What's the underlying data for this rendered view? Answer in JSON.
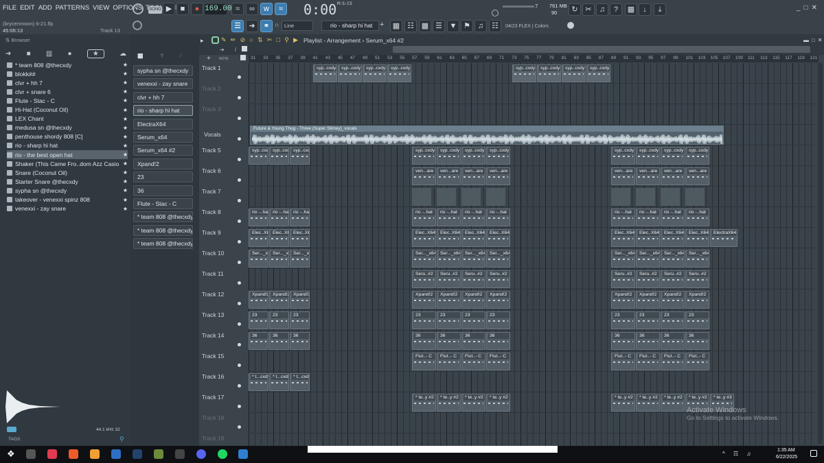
{
  "menu": [
    "FILE",
    "EDIT",
    "ADD",
    "PATTERNS",
    "VIEW",
    "OPTIONS",
    "TOOLS",
    "HELP"
  ],
  "project": {
    "file": "(brycenmoon) 6-21.flp",
    "time": "45:06:13",
    "track": "Track 13"
  },
  "transport": {
    "song_label": "SONG",
    "tempo": "169.000",
    "time": "0:00",
    "time_unit": "M:S:CS"
  },
  "monitor": {
    "memory": "761 MB",
    "cpu": "90",
    "step": "7"
  },
  "tools": {
    "snap": "Line",
    "channel": "rio - sharp hi hat",
    "hint": "04/23  FLEX | Colors"
  },
  "browser": {
    "title": "Browser",
    "items": [
      "* team 808 @thecxdy",
      "blokk##",
      "clvr + hh 7",
      "clvr + snare 6",
      "Flute - Stac - C",
      "Hi-Hat (Coconut Oil)",
      "LEX Chant",
      "medusa sn @thecxdy",
      "penthouse shordy 808 [C]",
      "rio - sharp hi hat",
      "rio - the best open hat",
      "Shaker (This Came Fro..dom Azz Casio Keyboard)",
      "Snare (Coconut Oil)",
      "Starter Snare @thecxdy",
      "sypha sn @thecxdy",
      "takeover - venexxi spinz 808",
      "venexxi - zay snare"
    ],
    "selected_index": 10,
    "sample_info": "44.1 kHz 32",
    "tags_label": "TAGS"
  },
  "channels": [
    "sypha sn @thecxdy",
    "venexxi - zay snare",
    "clvr + hh 7",
    "rio - sharp hi hat",
    "ElectraX64",
    "Serum_x64",
    "Serum_x64 #2",
    "Xpand!2",
    "23",
    "36",
    "Flute - Stac - C",
    "* team 808 @thecxdy",
    "* team 808 @thecxdy #2",
    "* team 808 @thecxdy #3"
  ],
  "playlist": {
    "breadcrumb": "Playlist - Arrangement › Serum_x64 #2",
    "tracks": [
      "Track 1",
      "Track 2",
      "Track 3",
      "Vocals",
      "Track 5",
      "Track 6",
      "Track 7",
      "Track 8",
      "Track 9",
      "Track 10",
      "Track 11",
      "Track 12",
      "Track 13",
      "Track 14",
      "Track 15",
      "Track 16",
      "Track 17",
      "Track 18",
      "Track 19"
    ],
    "bars": [
      "31",
      "33",
      "35",
      "37",
      "39",
      "41",
      "43",
      "45",
      "47",
      "49",
      "51",
      "53",
      "55",
      "57",
      "59",
      "61",
      "63",
      "65",
      "67",
      "69",
      "71",
      "73",
      "75",
      "77",
      "79",
      "81",
      "83",
      "85",
      "87",
      "89",
      "91",
      "93",
      "95",
      "97",
      "99",
      "101",
      "103",
      "105",
      "107",
      "109",
      "111",
      "113",
      "115",
      "117",
      "119",
      "121"
    ],
    "vocal_clip": "Future & Young Thug - Three (Super Slimey)_vocals",
    "clip_labels": {
      "t1": "syp..cxdy",
      "t5": "syp..cxdy",
      "t6": "ven...are",
      "t8": "rio -..hat",
      "t9": "Elec..X64",
      "t9b": "ElectraX64",
      "t10": "Ser..._x64",
      "t11": "Seru..#2",
      "t12": "Xpand!2",
      "t13": "23",
      "t14": "36",
      "t15": "Flut..- C",
      "t16": "* t...cxdy",
      "t17": "* te..y #2",
      "t17b": "* te..y #3"
    }
  },
  "watermark": {
    "title": "Activate Windows",
    "sub": "Go to Settings to activate Windows."
  },
  "taskbar": {
    "time": "1:35 AM",
    "date": "6/22/2025"
  }
}
